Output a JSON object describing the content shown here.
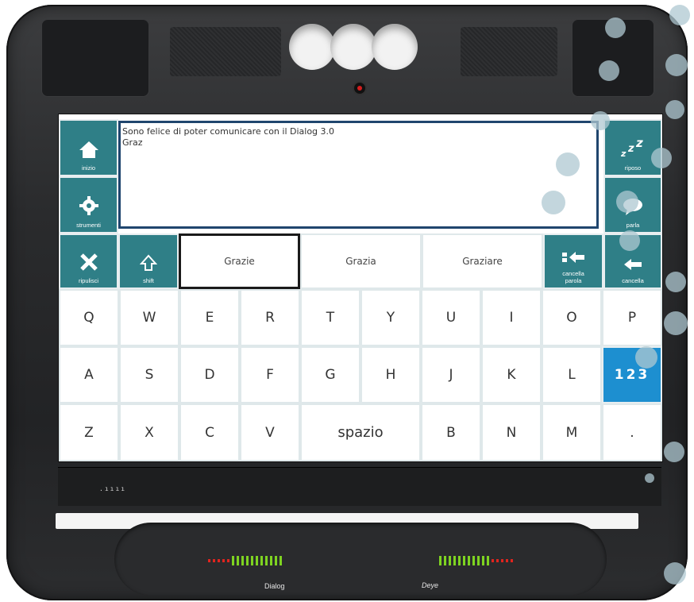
{
  "textbox": {
    "line1": "Sono felice di poter comunicare con il Dialog 3.0",
    "line2": "Graz"
  },
  "left_tools": {
    "home": "inizio",
    "settings": "strumenti",
    "clear": "ripulisci",
    "shift": "shift"
  },
  "right_tools": {
    "sleep": "riposo",
    "speak": "parla",
    "delete_word_line1": "cancella",
    "delete_word_line2": "parola",
    "delete": "cancella",
    "numbers": "123"
  },
  "suggestions": [
    "Grazie",
    "Grazia",
    "Graziare"
  ],
  "keys": {
    "row1": [
      "Q",
      "W",
      "E",
      "R",
      "T",
      "Y",
      "U",
      "I",
      "O",
      "P"
    ],
    "row2": [
      "A",
      "S",
      "D",
      "F",
      "G",
      "H",
      "J",
      "K",
      "L"
    ],
    "row3_left": [
      "Z",
      "X",
      "C",
      "V"
    ],
    "space": "spazio",
    "row3_right": [
      "B",
      "N",
      "M",
      "."
    ]
  },
  "brand": {
    "left_logo": "Dialog",
    "right_logo": "Deye"
  },
  "colors": {
    "tool_teal": "#2f7f87",
    "tool_blue": "#1d8fd0",
    "textbox_border": "#20466e",
    "meter_green": "#7ed321",
    "meter_red": "#e0241e"
  },
  "icons": [
    "home-icon",
    "gear-icon",
    "close-icon",
    "shift-arrow-icon",
    "sleep-zzz-icon",
    "speech-bubble-icon",
    "delete-word-icon",
    "backspace-arrow-icon"
  ]
}
